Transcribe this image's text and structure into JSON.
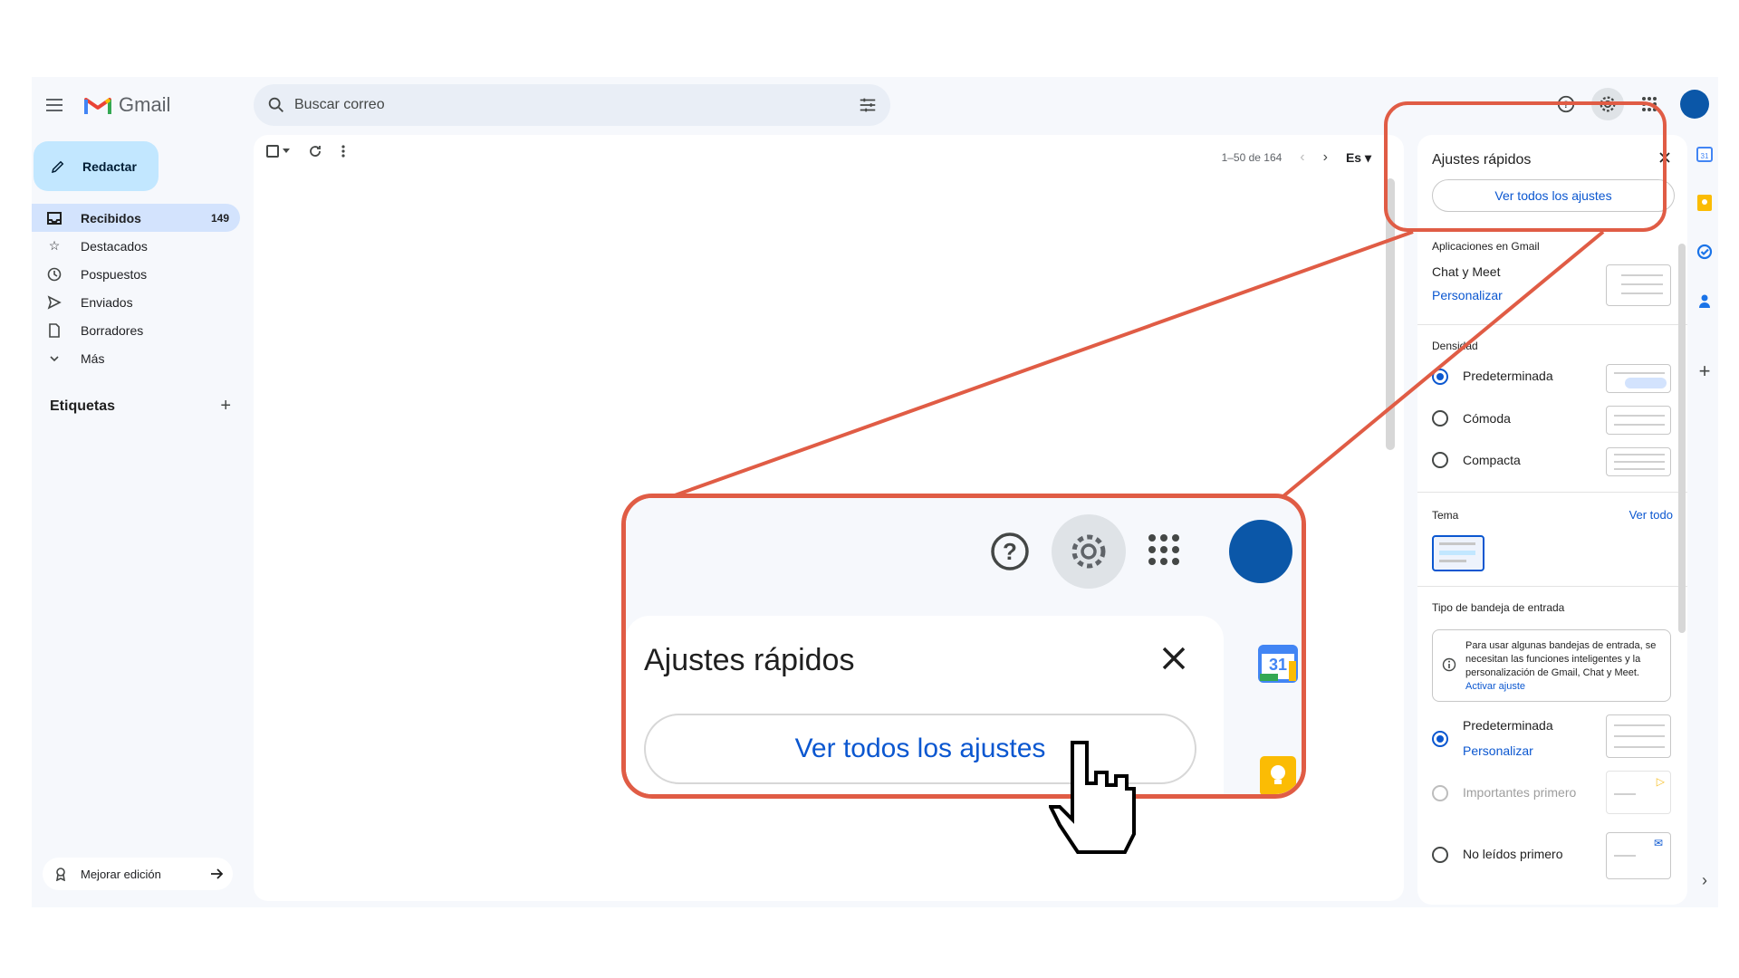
{
  "app": {
    "name": "Gmail"
  },
  "search": {
    "placeholder": "Buscar correo"
  },
  "compose": {
    "label": "Redactar"
  },
  "nav": {
    "items": [
      {
        "label": "Recibidos",
        "count": "149",
        "icon": "inbox-icon"
      },
      {
        "label": "Destacados",
        "icon": "star-icon"
      },
      {
        "label": "Pospuestos",
        "icon": "clock-icon"
      },
      {
        "label": "Enviados",
        "icon": "send-icon"
      },
      {
        "label": "Borradores",
        "icon": "draft-icon"
      },
      {
        "label": "Más",
        "icon": "chevron-down-icon"
      }
    ]
  },
  "labels": {
    "title": "Etiquetas"
  },
  "upgrade": {
    "label": "Mejorar edición"
  },
  "toolbar": {
    "pager": "1–50 de 164",
    "lang": "Es"
  },
  "quick_settings": {
    "title": "Ajustes rápidos",
    "all_settings": "Ver todos los ajustes",
    "apps_section": "Aplicaciones en Gmail",
    "chat_meet": "Chat y Meet",
    "customize": "Personalizar",
    "density_section": "Densidad",
    "density_options": [
      "Predeterminada",
      "Cómoda",
      "Compacta"
    ],
    "density_selected": "Predeterminada",
    "theme_section": "Tema",
    "theme_view_all": "Ver todo",
    "inbox_type_section": "Tipo de bandeja de entrada",
    "inbox_info": "Para usar algunas bandejas de entrada, se necesitan las funciones inteligentes y la personalización de Gmail, Chat y Meet.",
    "inbox_info_link": "Activar ajuste",
    "inbox_options": [
      "Predeterminada",
      "Importantes primero",
      "No leídos primero"
    ],
    "inbox_customize": "Personalizar"
  },
  "zoom_callout": {
    "title": "Ajustes rápidos",
    "button": "Ver todos los ajustes",
    "calendar_day": "31"
  },
  "colors": {
    "accent": "#0b57d0",
    "highlight": "#e05c45",
    "avatar": "#0b57a8"
  }
}
